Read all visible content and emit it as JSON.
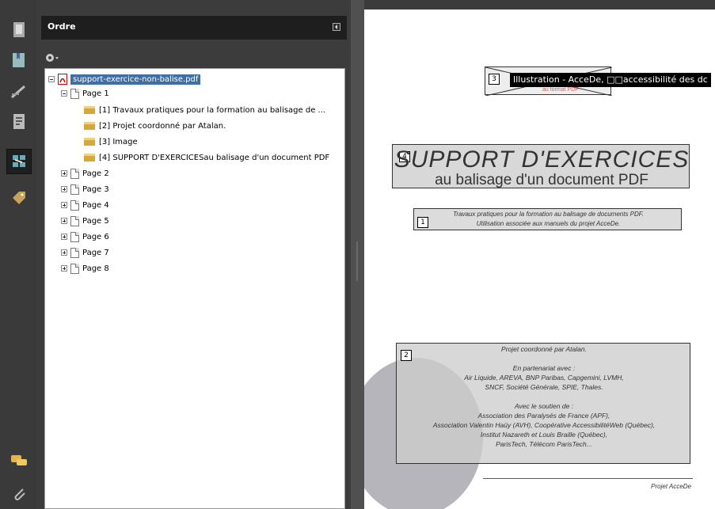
{
  "panel": {
    "title": "Ordre"
  },
  "tree": {
    "root": "support-exercice-non-balise.pdf",
    "page1": "Page 1",
    "items": [
      "[1] Travaux pratiques pour la formation au balisage de ...",
      "[2] Projet coordonné par Atalan.",
      "[3] Image",
      "[4] SUPPORT D'EXERCICESau balisage d'un document PDF"
    ],
    "pages": [
      "Page 2",
      "Page 3",
      "Page 4",
      "Page 5",
      "Page 6",
      "Page 7",
      "Page 8"
    ]
  },
  "document": {
    "tooltip": "Illustration - AcceDe, □□accessibilité des dc",
    "logo_sub": "au format PDF",
    "tag_numbers": [
      "1",
      "2",
      "3",
      "4"
    ],
    "title_main": "SUPPORT D'EXERCICES",
    "title_sub": "au balisage d'un document PDF",
    "tp_line1": "Travaux pratiques pour la formation au balisage de documents PDF.",
    "tp_line2": "Utilisation associée aux manuels du projet AcceDe.",
    "projet_lines": [
      "Projet coordonné par Atalan.",
      "",
      "En partenariat avec :",
      "Air Liquide, AREVA, BNP Paribas, Capgemini, LVMH,",
      "SNCF, Société Générale, SPIE, Thales.",
      "",
      "Avec le soutien de :",
      "Association des Paralysés de France (APF),",
      "Association Valentin Haüy (AVH), Coopérative AccessibilitéWeb (Québec),",
      "Institut Nazareth et Louis Braille (Québec),",
      "ParisTech, Télécom ParisTech..."
    ],
    "footer": "Projet AcceDe"
  }
}
